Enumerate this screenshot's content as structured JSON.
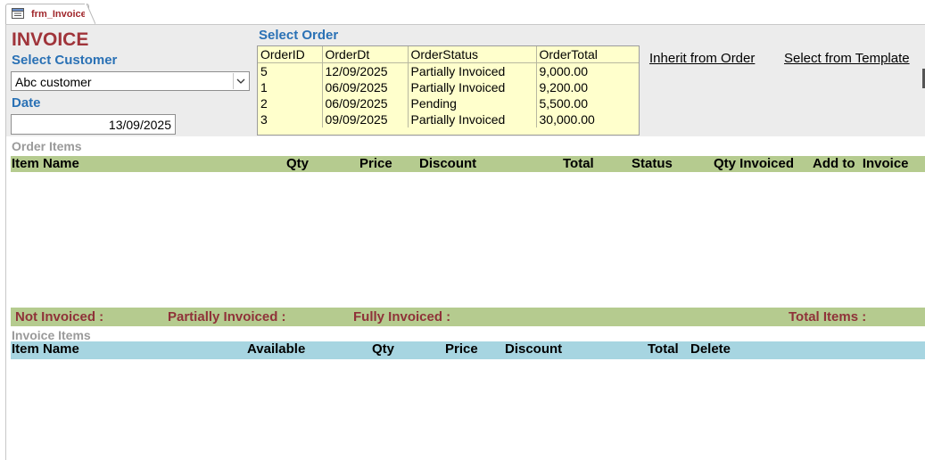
{
  "tab": {
    "label": "frm_Invoice",
    "icon": "form-icon"
  },
  "form": {
    "title": "INVOICE",
    "select_customer_label": "Select Customer",
    "customer_value": "Abc customer",
    "date_label": "Date",
    "date_value": "13/09/2025",
    "select_order_label": "Select Order"
  },
  "orders": {
    "columns": [
      "OrderID",
      "OrderDt",
      "OrderStatus",
      "OrderTotal"
    ],
    "rows": [
      [
        "5",
        "12/09/2025",
        "Partially Invoiced",
        "9,000.00"
      ],
      [
        "1",
        "06/09/2025",
        "Partially Invoiced",
        "9,200.00"
      ],
      [
        "2",
        "06/09/2025",
        "Pending",
        "5,500.00"
      ],
      [
        "3",
        "09/09/2025",
        "Partially Invoiced",
        "30,000.00"
      ]
    ]
  },
  "actions": {
    "inherit": "Inherit from Order",
    "template": "Select from Template"
  },
  "order_items": {
    "section_label": "Order Items",
    "columns": [
      "Item Name",
      "Qty",
      "Price",
      "Discount",
      "Total",
      "Status",
      "Qty Invoiced",
      "Add to  Invoice"
    ]
  },
  "summary": {
    "not_invoiced": "Not Invoiced :",
    "partially_invoiced": "Partially Invoiced :",
    "fully_invoiced": "Fully Invoiced :",
    "total_items": "Total Items :"
  },
  "invoice_items": {
    "section_label": "Invoice Items",
    "columns": [
      "Item Name",
      "Available",
      "Qty",
      "Price",
      "Discount",
      "Total",
      "Delete"
    ]
  },
  "colors": {
    "title": "#a0343a",
    "label_blue": "#2a71b5",
    "order_grid_bg": "#ffffcc",
    "green_bar": "#b5cb8f",
    "blue_bar": "#a7d5e1"
  }
}
